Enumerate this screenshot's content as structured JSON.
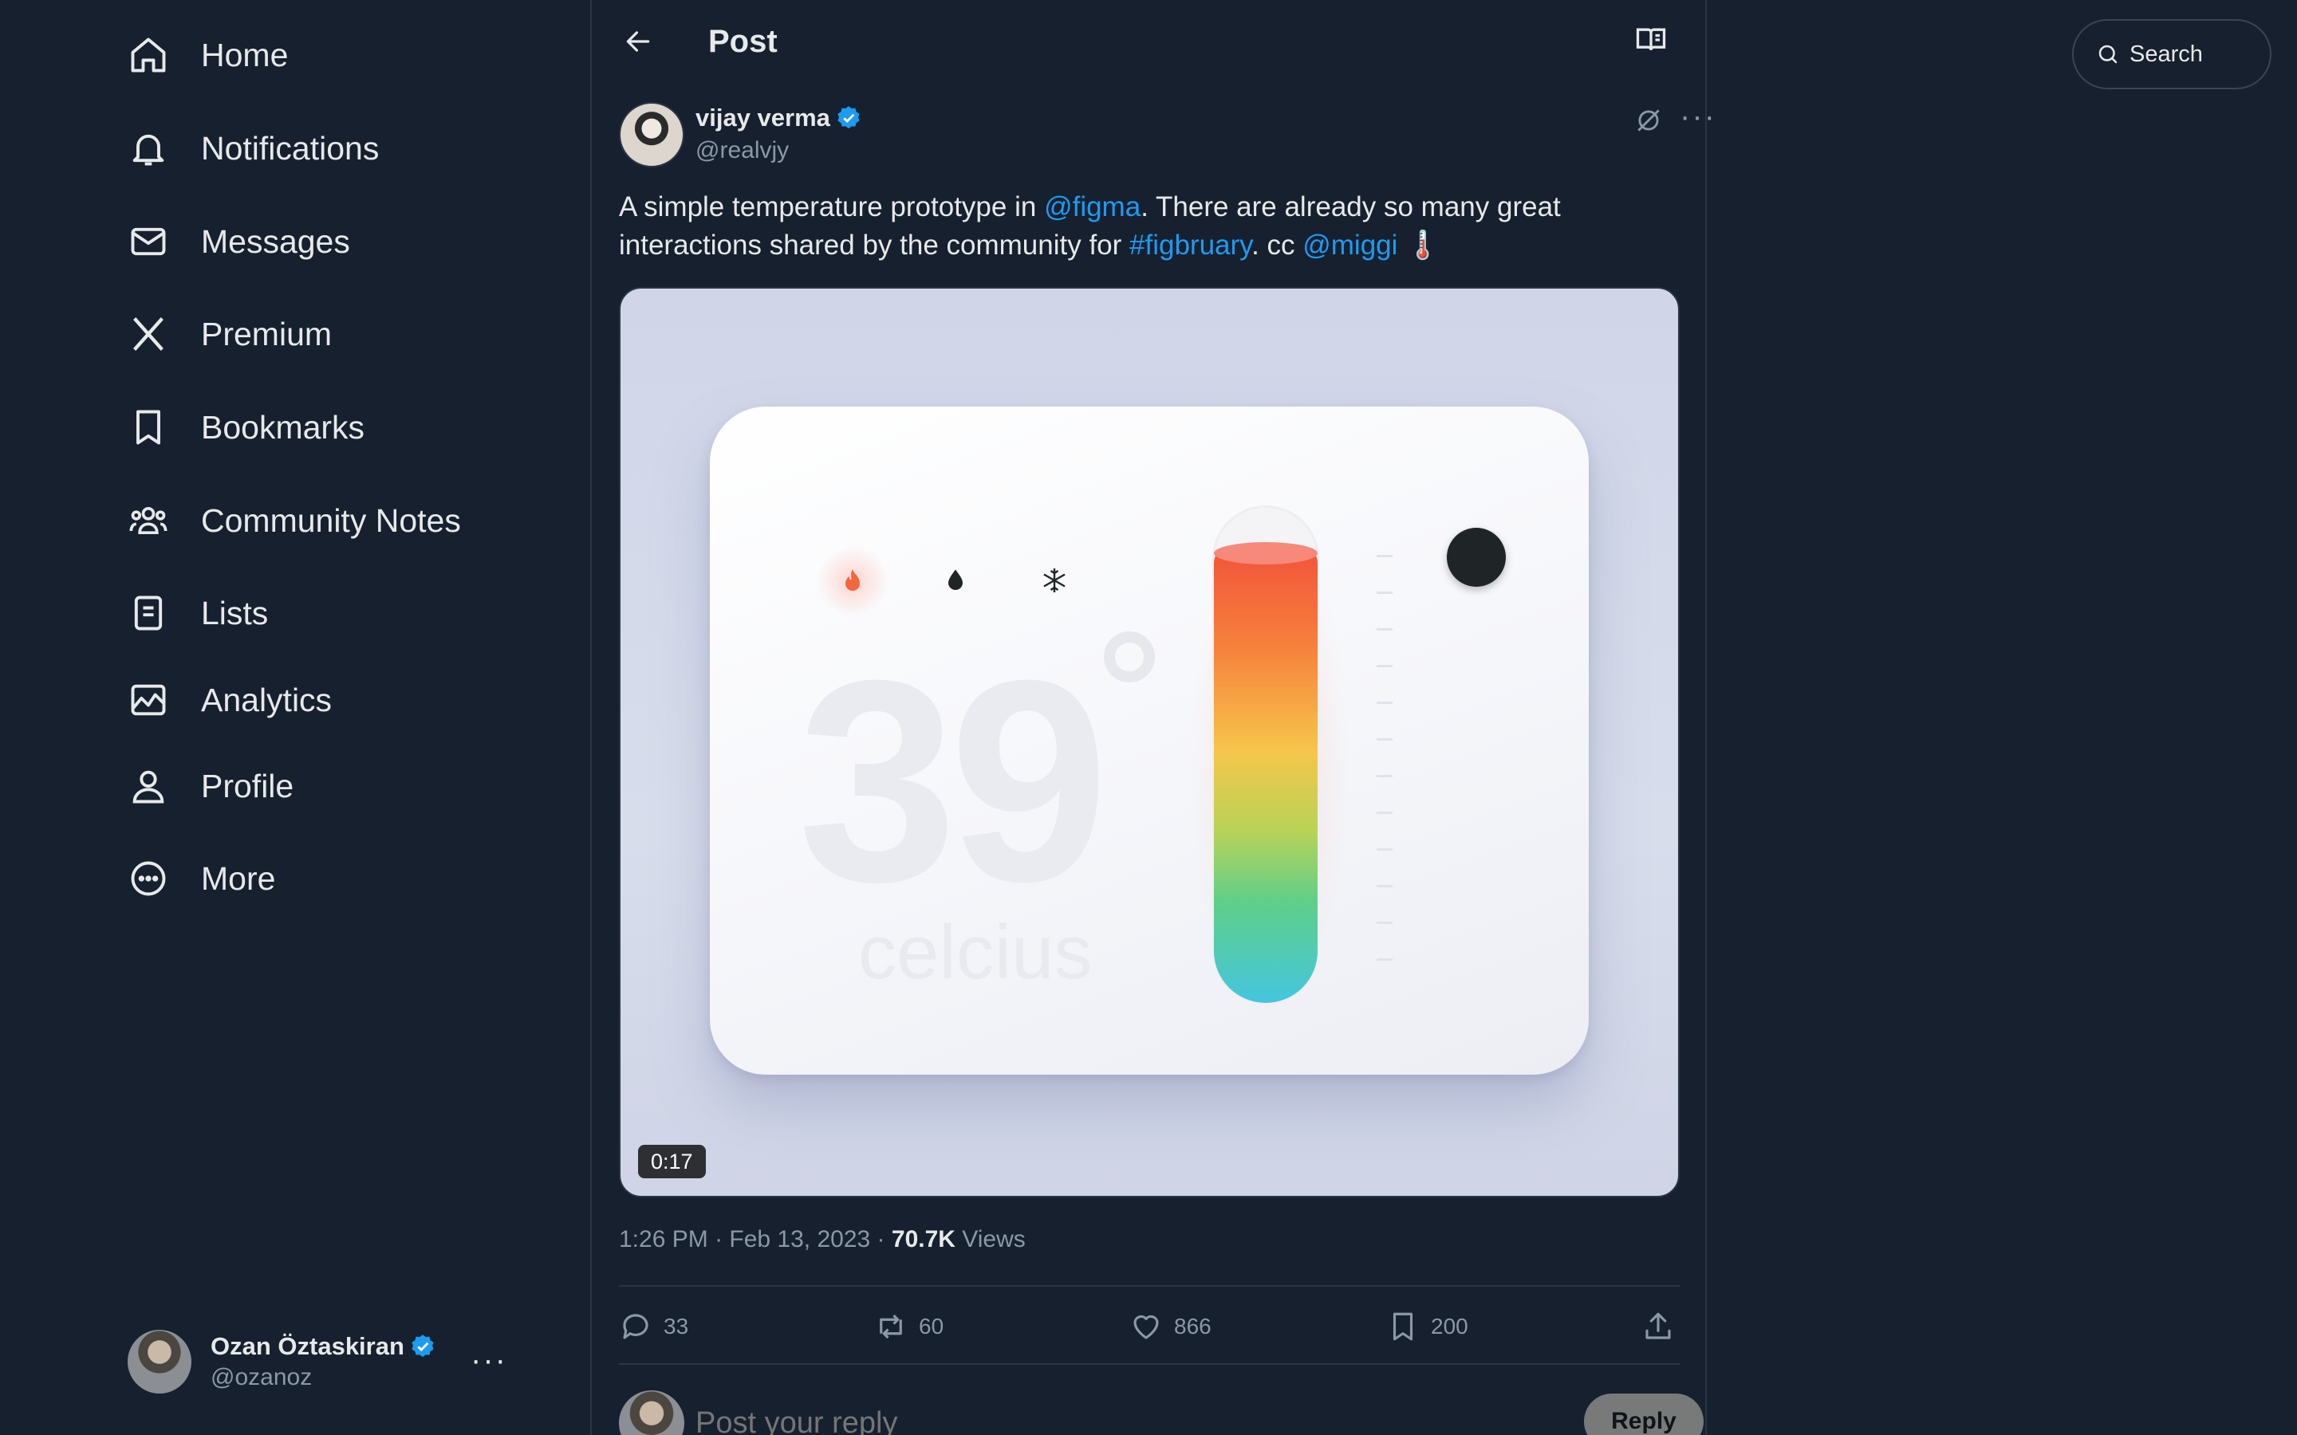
{
  "sidebar": {
    "items": [
      {
        "label": "Home",
        "icon": "home-icon"
      },
      {
        "label": "Notifications",
        "icon": "bell-icon"
      },
      {
        "label": "Messages",
        "icon": "envelope-icon"
      },
      {
        "label": "Premium",
        "icon": "x-logo-icon"
      },
      {
        "label": "Bookmarks",
        "icon": "bookmark-icon"
      },
      {
        "label": "Community Notes",
        "icon": "people-icon"
      },
      {
        "label": "Lists",
        "icon": "list-icon"
      },
      {
        "label": "Analytics",
        "icon": "analytics-icon"
      },
      {
        "label": "Profile",
        "icon": "person-icon"
      },
      {
        "label": "More",
        "icon": "more-circle-icon"
      }
    ],
    "account": {
      "name": "Ozan Öztaskiran",
      "handle": "@ozanoz",
      "more": "···"
    }
  },
  "header": {
    "title": "Post"
  },
  "post": {
    "author": {
      "name": "vijay verma",
      "handle": "@realvjy"
    },
    "more": "···",
    "text": {
      "t1": "A simple temperature prototype in ",
      "mention1": "@figma",
      "t2": ". There are already so many great interactions shared by the community for ",
      "hashtag": "#figbruary",
      "t3": ". cc ",
      "mention2": "@miggi",
      "emoji": " 🌡️"
    },
    "media": {
      "temperature": "39",
      "unit": "celcius",
      "duration": "0:17"
    },
    "meta": {
      "time": "1:26 PM",
      "sep1": " · ",
      "date": "Feb 13, 2023",
      "sep2": " · ",
      "views_count": "70.7K",
      "views_label": " Views"
    },
    "actions": {
      "replies": "33",
      "reposts": "60",
      "likes": "866",
      "bookmarks": "200"
    }
  },
  "reply": {
    "placeholder": "Post your reply",
    "button": "Reply"
  },
  "search": {
    "label": "Search"
  },
  "colors": {
    "background": "#16202f",
    "accent": "#1d9bf0",
    "text": "#e7e9ea",
    "muted": "#8b98a5"
  }
}
